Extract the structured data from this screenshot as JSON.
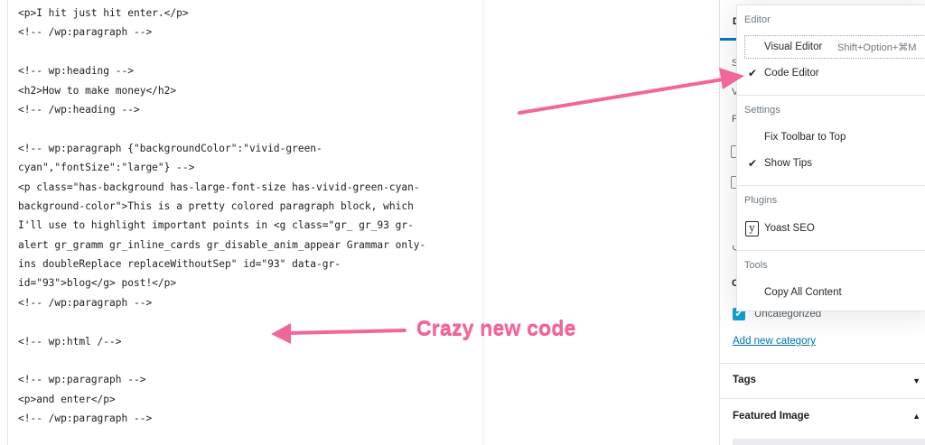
{
  "code_lines": [
    "<p>I hit just hit enter.</p>",
    "<!-- /wp:paragraph -->",
    "",
    "<!-- wp:heading -->",
    "<h2>How to make money</h2>",
    "<!-- /wp:heading -->",
    "",
    "<!-- wp:paragraph {\"backgroundColor\":\"vivid-green-",
    "cyan\",\"fontSize\":\"large\"} -->",
    "<p class=\"has-background has-large-font-size has-vivid-green-cyan-",
    "background-color\">This is a pretty colored paragraph block, which",
    "I'll use to highlight important points in <g class=\"gr_ gr_93 gr-",
    "alert gr_gramm gr_inline_cards gr_disable_anim_appear Grammar only-",
    "ins doubleReplace replaceWithoutSep\" id=\"93\" data-gr-",
    "id=\"93\">blog</g> post!</p>",
    "<!-- /wp:paragraph -->",
    "",
    "<!-- wp:html /-->",
    "",
    "<!-- wp:paragraph -->",
    "<p>and enter</p>",
    "<!-- /wp:paragraph -->"
  ],
  "sidebar": {
    "tab_fragment": "D",
    "frag_s": "S",
    "frag_v": "V",
    "frag_p": "P",
    "frag_c": "C",
    "category_label": "Uncategorized",
    "add_category": "Add new category",
    "tags_label": "Tags",
    "featured_image_label": "Featured Image",
    "caret_down": "▼",
    "caret_up": "▲"
  },
  "menu": {
    "editor_group": "Editor",
    "visual_editor": "Visual Editor",
    "visual_editor_shortcut": "Shift+Option+⌘M",
    "code_editor": "Code Editor",
    "settings_group": "Settings",
    "fix_toolbar": "Fix Toolbar to Top",
    "show_tips": "Show Tips",
    "plugins_group": "Plugins",
    "yoast_seo": "Yoast SEO",
    "tools_group": "Tools",
    "copy_all": "Copy All Content",
    "check": "✔"
  },
  "annotation": {
    "label": "Crazy new code",
    "color": "#f2679b"
  }
}
